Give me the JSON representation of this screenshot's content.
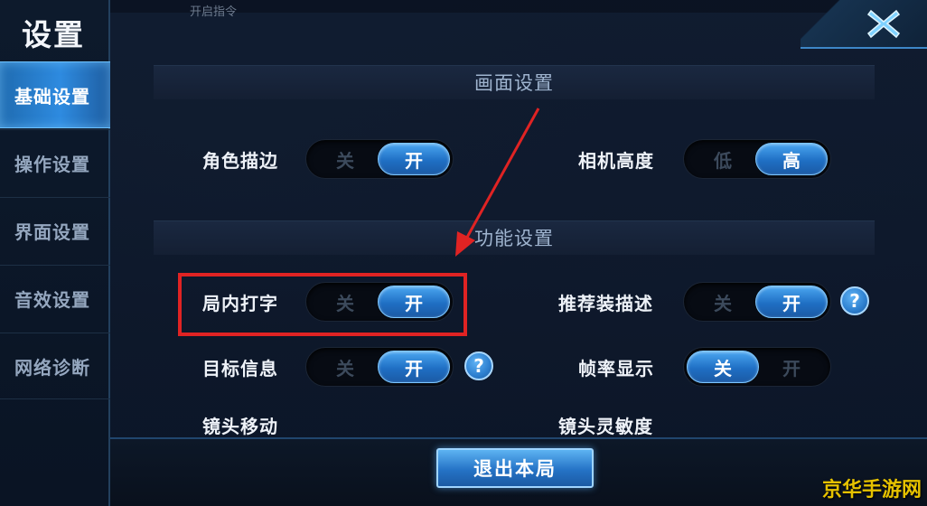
{
  "sidebar": {
    "title": "设置",
    "items": [
      {
        "label": "基础设置",
        "active": true
      },
      {
        "label": "操作设置",
        "active": false
      },
      {
        "label": "界面设置",
        "active": false
      },
      {
        "label": "音效设置",
        "active": false
      },
      {
        "label": "网络诊断",
        "active": false
      }
    ]
  },
  "header": {
    "hint": "开启指令"
  },
  "sections": {
    "display": "画面设置",
    "function": "功能设置"
  },
  "settings": {
    "outline": {
      "label": "角色描边",
      "off": "关",
      "on": "开",
      "selected": "开"
    },
    "camera_height": {
      "label": "相机高度",
      "low": "低",
      "high": "高",
      "selected": "高"
    },
    "in_game_typing": {
      "label": "局内打字",
      "off": "关",
      "on": "开",
      "selected": "开"
    },
    "recommend_gear": {
      "label": "推荐装描述",
      "off": "关",
      "on": "开",
      "selected": "开"
    },
    "target_info": {
      "label": "目标信息",
      "off": "关",
      "on": "开",
      "selected": "开"
    },
    "fps_display": {
      "label": "帧率显示",
      "off": "关",
      "on": "开",
      "selected": "关"
    },
    "camera_move": {
      "label": "镜头移动"
    },
    "camera_sensitivity": {
      "label": "镜头灵敏度"
    }
  },
  "help_icon_text": "?",
  "close_icon": "close-icon",
  "exit_button": "退出本局",
  "watermark": "京华手游网",
  "colors": {
    "accent": "#2e8be0",
    "highlight": "#e02323",
    "watermark": "#e6c200"
  }
}
